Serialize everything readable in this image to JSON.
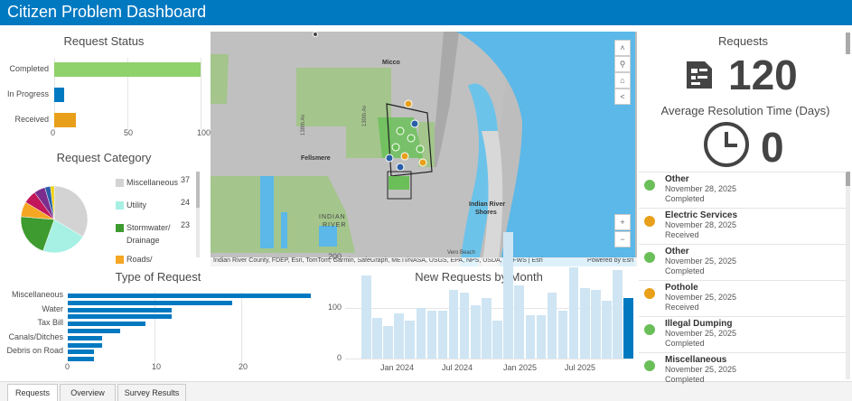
{
  "header": {
    "title": "Citizen Problem Dashboard"
  },
  "request_status": {
    "title": "Request Status",
    "categories": [
      "Completed",
      "In Progress",
      "Received"
    ],
    "values": [
      100,
      7,
      15
    ],
    "colors": [
      "#8fd16b",
      "#0079c1",
      "#e8a01a"
    ],
    "ticks": [
      "0",
      "50",
      "100"
    ]
  },
  "request_category": {
    "title": "Request Category",
    "legend": [
      {
        "label": "Miscellaneous",
        "value": "37",
        "color": "#d3d3d3"
      },
      {
        "label": "Utility",
        "value": "24",
        "color": "#a6f0e4"
      },
      {
        "label": "Stormwater/",
        "label2": "Drainage",
        "value": "23",
        "color": "#3d9b2f"
      },
      {
        "label": "Roads/",
        "value": "",
        "color": "#f5a623"
      }
    ],
    "pie": [
      {
        "value": 37,
        "color": "#d3d3d3"
      },
      {
        "value": 24,
        "color": "#a6f0e4"
      },
      {
        "value": 23,
        "color": "#3d9b2f"
      },
      {
        "value": 8,
        "color": "#f5a623"
      },
      {
        "value": 7,
        "color": "#c2185b"
      },
      {
        "value": 6,
        "color": "#7b2d8e"
      },
      {
        "value": 3,
        "color": "#2a5fa8"
      },
      {
        "value": 2,
        "color": "#f0d000"
      }
    ]
  },
  "type_of_request": {
    "title": "Type of Request",
    "labels": [
      "Miscellaneous",
      "Water",
      "Tax Bill",
      "Canals/Ditches",
      "Debris on Road"
    ],
    "values": [
      28,
      19,
      12,
      12,
      9,
      6,
      4,
      4,
      3,
      3
    ],
    "ticks": [
      "0",
      "10",
      "20"
    ]
  },
  "new_requests": {
    "title": "New Requests by Month",
    "yticks": [
      "200",
      "100",
      "0"
    ],
    "xticks": [
      "Jan 2024",
      "Jul 2024",
      "Jan 2025",
      "Jul 2025"
    ],
    "values": [
      165,
      80,
      65,
      90,
      75,
      100,
      95,
      95,
      135,
      130,
      105,
      120,
      75,
      250,
      145,
      85,
      85,
      130,
      95,
      180,
      140,
      135,
      115,
      175,
      120
    ]
  },
  "map": {
    "labels": {
      "micco": "Micco",
      "fellsmere": "Fellsmere",
      "indian_river": "INDIAN",
      "indian_river2": "RIVER",
      "ir_shores": "Indian River",
      "ir_shores2": "Shores",
      "vero": "Vero Beach",
      "road138": "138th Av",
      "road130": "130th Av"
    },
    "attribution": "Indian River County, FDEP, Esri, TomTom, Garmin, SafeGraph, METI/NASA, USGS, EPA, NPS, USDA, USFWS | Esri",
    "powered": "Powered by Esri"
  },
  "requests_panel": {
    "title": "Requests",
    "count": "120",
    "avg_title": "Average Resolution Time (Days)",
    "avg_value": "0"
  },
  "list": [
    {
      "name": "Other",
      "date": "November 28, 2025",
      "status": "Completed",
      "color": "#6bbf59"
    },
    {
      "name": "Electric Services",
      "date": "November 28, 2025",
      "status": "Received",
      "color": "#e8a01a"
    },
    {
      "name": "Other",
      "date": "November 25, 2025",
      "status": "Completed",
      "color": "#6bbf59"
    },
    {
      "name": "Pothole",
      "date": "November 25, 2025",
      "status": "Received",
      "color": "#e8a01a"
    },
    {
      "name": "Illegal Dumping",
      "date": "November 25, 2025",
      "status": "Completed",
      "color": "#6bbf59"
    },
    {
      "name": "Miscellaneous",
      "date": "November 25, 2025",
      "status": "Completed",
      "color": "#6bbf59"
    }
  ],
  "tabs": [
    "Requests",
    "Overview",
    "Survey Results"
  ]
}
